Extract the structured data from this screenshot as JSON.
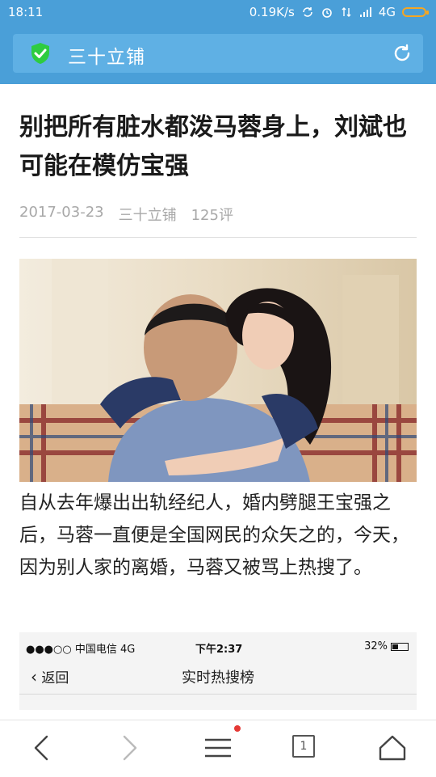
{
  "status_bar": {
    "time": "18:11",
    "speed": "0.19K/s",
    "network": "4G"
  },
  "app_bar": {
    "site_name": "三十立铺",
    "shield_color": "#2ecc40"
  },
  "article": {
    "title": "别把所有脏水都泼马蓉身上，刘斌也可能在模仿宝强",
    "date": "2017-03-23",
    "source": "三十立铺",
    "comments": "125评",
    "paragraph": "自从去年爆出出轨经纪人，婚内劈腿王宝强之后，马蓉一直便是全国网民的众矢之的，今天，因为别人家的离婚，马蓉又被骂上热搜了。"
  },
  "embedded_screenshot": {
    "carrier": "●●●○○ 中国电信  4G",
    "time": "下午2:37",
    "battery": "32%",
    "back_label": "返回",
    "nav_title": "实时热搜榜"
  },
  "bottom_nav": {
    "tab_count": "1",
    "badge_color": "#e53935"
  }
}
